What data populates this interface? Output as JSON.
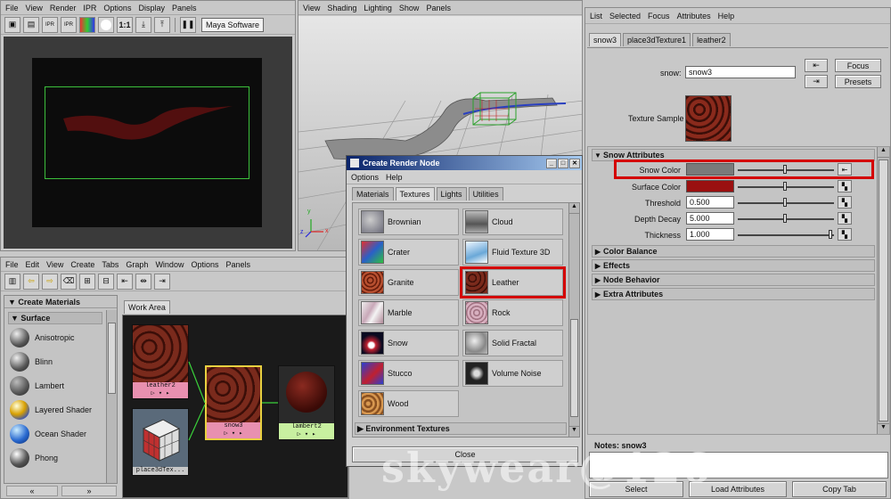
{
  "render_view": {
    "menu": [
      "File",
      "View",
      "Render",
      "IPR",
      "Options",
      "Display",
      "Panels"
    ],
    "ratio_label": "1:1",
    "renderer": "Maya Software"
  },
  "viewport": {
    "menu": [
      "View",
      "Shading",
      "Lighting",
      "Show",
      "Panels"
    ],
    "axis_labels": {
      "y": "y",
      "z": "z",
      "x": "x"
    }
  },
  "hypershade": {
    "menu": [
      "File",
      "Edit",
      "View",
      "Create",
      "Tabs",
      "Graph",
      "Window",
      "Options",
      "Panels"
    ],
    "create_materials_label": "Create Materials",
    "surface_label": "Surface",
    "materials": [
      "Anisotropic",
      "Blinn",
      "Lambert",
      "Layered Shader",
      "Ocean Shader",
      "Phong"
    ],
    "work_area_tab": "Work Area",
    "nodes": {
      "leather2": "leather2",
      "place3d": "place3dTex...",
      "snow3": "snow3",
      "lambert2": "lambert2"
    },
    "scroll_left": "«",
    "scroll_right": "»"
  },
  "create_render_node": {
    "title": "Create Render Node",
    "menu": [
      "Options",
      "Help"
    ],
    "tabs": [
      "Materials",
      "Textures",
      "Lights",
      "Utilities"
    ],
    "textures": [
      {
        "name": "Brownian",
        "color": "#9a9aa2"
      },
      {
        "name": "Cloud",
        "color": "#8e8e8e"
      },
      {
        "name": "Crater",
        "color": "#2a60c8"
      },
      {
        "name": "Fluid Texture 3D",
        "color": "#b8d8ee"
      },
      {
        "name": "Granite",
        "color": "#8a3020"
      },
      {
        "name": "Leather",
        "color": "#6a1d12"
      },
      {
        "name": "Marble",
        "color": "#d8c8cc"
      },
      {
        "name": "Rock",
        "color": "#b890a0"
      },
      {
        "name": "Snow",
        "color": "#0a0a20"
      },
      {
        "name": "Solid Fractal",
        "color": "#a8a8a8"
      },
      {
        "name": "Stucco",
        "color": "#c02030"
      },
      {
        "name": "Volume Noise",
        "color": "#1a1a1a"
      },
      {
        "name": "Wood",
        "color": "#b87838"
      }
    ],
    "section_environment": "Environment Textures",
    "close_label": "Close"
  },
  "attribute_editor": {
    "menu": [
      "List",
      "Selected",
      "Focus",
      "Attributes",
      "Help"
    ],
    "tabs": [
      "snow3",
      "place3dTexture1",
      "leather2"
    ],
    "node_label": "snow:",
    "node_name": "snow3",
    "focus_label": "Focus",
    "presets_label": "Presets",
    "texture_sample_label": "Texture Sample",
    "snow_attributes_label": "Snow Attributes",
    "attributes": [
      {
        "label": "Snow Color",
        "value": "",
        "swatch": "#7a7a7a",
        "slider": 0.48
      },
      {
        "label": "Surface Color",
        "value": "",
        "swatch": "#9a1010",
        "slider": 0.48
      },
      {
        "label": "Threshold",
        "value": "0.500",
        "slider": 0.48
      },
      {
        "label": "Depth Decay",
        "value": "5.000",
        "slider": 0.48
      },
      {
        "label": "Thickness",
        "value": "1.000",
        "slider": 0.98
      }
    ],
    "collapsed_sections": [
      "Color Balance",
      "Effects",
      "Node Behavior",
      "Extra Attributes"
    ],
    "notes_label": "Notes:  snow3",
    "buttons": [
      "Select",
      "Load Attributes",
      "Copy Tab"
    ]
  },
  "watermark": "skywear@126",
  "colors": {
    "highlight": "#d40000",
    "leather": "#6a1d12",
    "node_pink": "#e890b0",
    "node_green": "#c8f0a0"
  }
}
